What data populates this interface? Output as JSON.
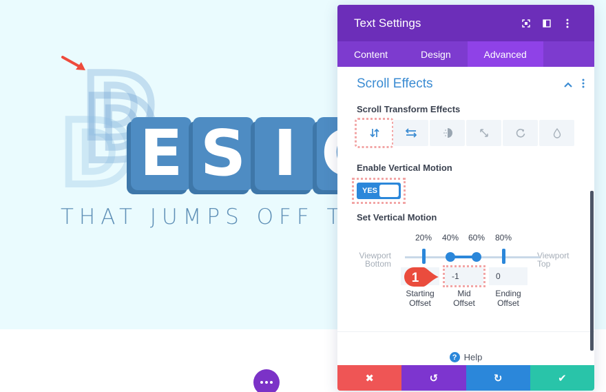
{
  "canvas": {
    "heading_first_letter": "D",
    "heading_rest": [
      "E",
      "S",
      "I",
      "G"
    ],
    "subtitle": "THAT JUMPS OFF THE PAGE",
    "colors": {
      "background": "#eafbfe",
      "letter_fill": "#4e8cc3",
      "subtitle": "#5e8fb6",
      "arrow": "#ee4b3c"
    },
    "more_button_icon": "ellipsis-icon"
  },
  "panel": {
    "title": "Text Settings",
    "header_icons": [
      "fullscreen-icon",
      "sidebar-layout-icon",
      "more-vertical-icon"
    ],
    "tabs": [
      {
        "label": "Content",
        "active": false
      },
      {
        "label": "Design",
        "active": false
      },
      {
        "label": "Advanced",
        "active": true
      }
    ],
    "section": {
      "title": "Scroll Effects",
      "expanded": true
    },
    "scroll_transform": {
      "label": "Scroll Transform Effects",
      "effects": [
        {
          "name": "vertical-motion",
          "icon": "↓↑",
          "active": true
        },
        {
          "name": "horizontal-motion",
          "icon": "⇄",
          "active": false
        },
        {
          "name": "fading",
          "icon": "◑",
          "active": false
        },
        {
          "name": "scaling",
          "icon": "⤡",
          "active": false
        },
        {
          "name": "rotating",
          "icon": "↻",
          "active": false
        },
        {
          "name": "blur",
          "icon": "◇",
          "active": false
        }
      ]
    },
    "enable_vertical_motion": {
      "label": "Enable Vertical Motion",
      "value": "YES",
      "enabled": true
    },
    "set_vertical_motion": {
      "label": "Set Vertical Motion",
      "percent_labels": [
        "20%",
        "40%",
        "60%",
        "80%"
      ],
      "viewport_bottom": [
        "Viewport",
        "Bottom"
      ],
      "viewport_top": [
        "Viewport",
        "Top"
      ],
      "range_start_pct": 20,
      "mid_start_pct": 40,
      "mid_end_pct": 60,
      "range_end_pct": 80,
      "starting_offset": "",
      "mid_offset": "-1",
      "ending_offset": "0",
      "starting_offset_label": [
        "Starting",
        "Offset"
      ],
      "mid_offset_label": [
        "Mid",
        "Offset"
      ],
      "ending_offset_label": [
        "Ending",
        "Offset"
      ]
    },
    "callout_number": "1",
    "help_label": "Help",
    "footer": {
      "cancel_icon": "✖",
      "undo_icon": "↺",
      "redo_icon": "↻",
      "save_icon": "✔"
    },
    "colors": {
      "header": "#6c2eb9",
      "tabs": "#7d3bcf",
      "active_tab": "#8f42e7",
      "accent": "#2b87da",
      "cancel": "#ef5555",
      "undo": "#7d35cf",
      "redo": "#2b87da",
      "save": "#29c4a9"
    }
  }
}
